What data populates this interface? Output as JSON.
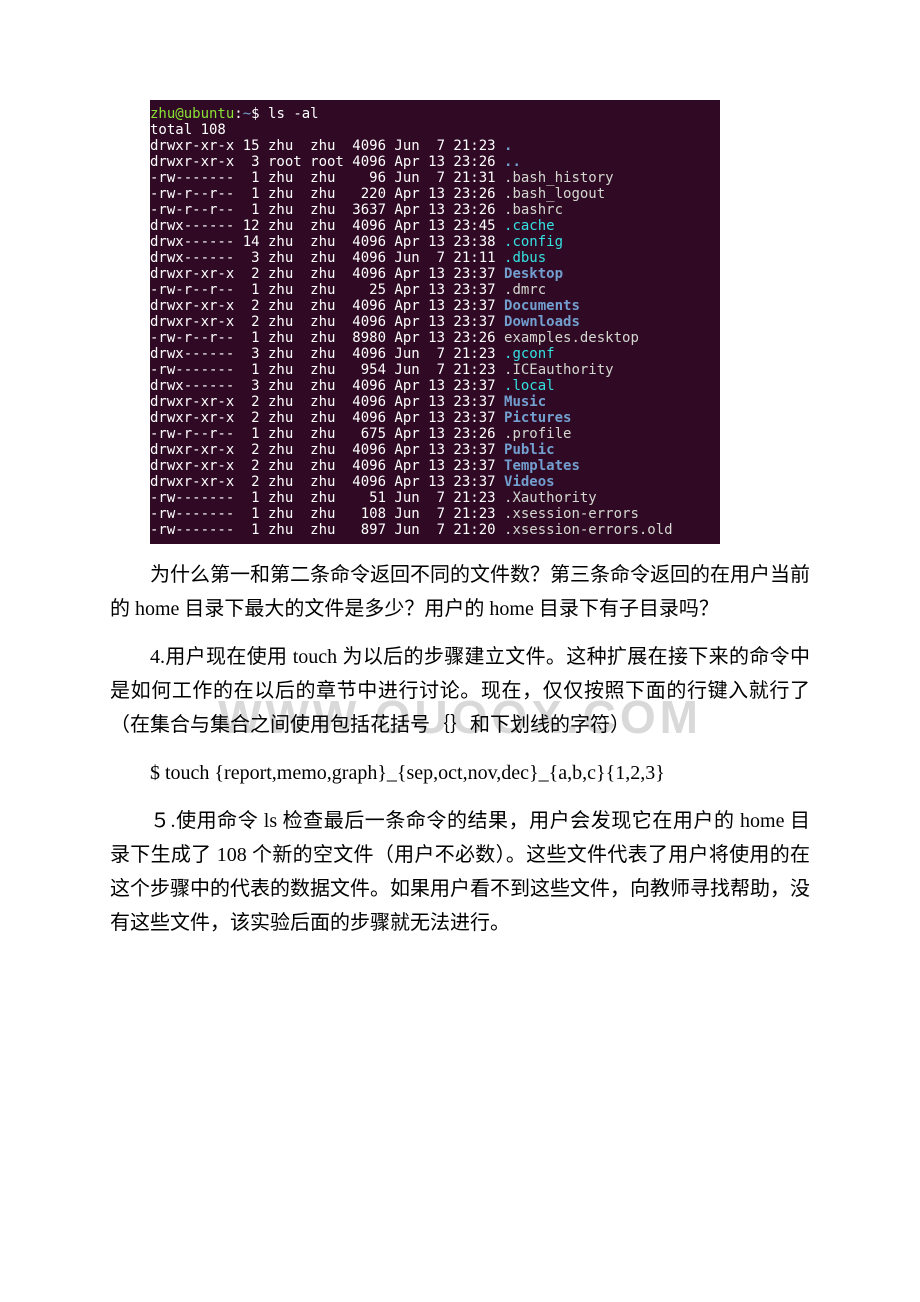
{
  "terminal": {
    "prompt": {
      "user": "zhu@ubuntu",
      "sep": ":",
      "path": "~",
      "sym": "$ ",
      "command": "ls -al"
    },
    "totals": "total 108",
    "rows": [
      {
        "perm": "drwxr-xr-x",
        "n": "15",
        "o": "zhu",
        "g": "zhu",
        "s": "4096",
        "m": "Jun",
        "d": " 7",
        "t": "21:23",
        "name": ".",
        "cls": "dir"
      },
      {
        "perm": "drwxr-xr-x",
        "n": " 3",
        "o": "root",
        "g": "root",
        "s": "4096",
        "m": "Apr",
        "d": "13",
        "t": "23:26",
        "name": "..",
        "cls": "dir"
      },
      {
        "perm": "-rw-------",
        "n": " 1",
        "o": "zhu",
        "g": "zhu",
        "s": "  96",
        "m": "Jun",
        "d": " 7",
        "t": "21:31",
        "name": ".bash_history",
        "cls": "norm"
      },
      {
        "perm": "-rw-r--r--",
        "n": " 1",
        "o": "zhu",
        "g": "zhu",
        "s": " 220",
        "m": "Apr",
        "d": "13",
        "t": "23:26",
        "name": ".bash_logout",
        "cls": "norm"
      },
      {
        "perm": "-rw-r--r--",
        "n": " 1",
        "o": "zhu",
        "g": "zhu",
        "s": "3637",
        "m": "Apr",
        "d": "13",
        "t": "23:26",
        "name": ".bashrc",
        "cls": "norm"
      },
      {
        "perm": "drwx------",
        "n": "12",
        "o": "zhu",
        "g": "zhu",
        "s": "4096",
        "m": "Apr",
        "d": "13",
        "t": "23:45",
        "name": ".cache",
        "cls": "hid"
      },
      {
        "perm": "drwx------",
        "n": "14",
        "o": "zhu",
        "g": "zhu",
        "s": "4096",
        "m": "Apr",
        "d": "13",
        "t": "23:38",
        "name": ".config",
        "cls": "hid"
      },
      {
        "perm": "drwx------",
        "n": " 3",
        "o": "zhu",
        "g": "zhu",
        "s": "4096",
        "m": "Jun",
        "d": " 7",
        "t": "21:11",
        "name": ".dbus",
        "cls": "hid"
      },
      {
        "perm": "drwxr-xr-x",
        "n": " 2",
        "o": "zhu",
        "g": "zhu",
        "s": "4096",
        "m": "Apr",
        "d": "13",
        "t": "23:37",
        "name": "Desktop",
        "cls": "dir"
      },
      {
        "perm": "-rw-r--r--",
        "n": " 1",
        "o": "zhu",
        "g": "zhu",
        "s": "  25",
        "m": "Apr",
        "d": "13",
        "t": "23:37",
        "name": ".dmrc",
        "cls": "norm"
      },
      {
        "perm": "drwxr-xr-x",
        "n": " 2",
        "o": "zhu",
        "g": "zhu",
        "s": "4096",
        "m": "Apr",
        "d": "13",
        "t": "23:37",
        "name": "Documents",
        "cls": "dir"
      },
      {
        "perm": "drwxr-xr-x",
        "n": " 2",
        "o": "zhu",
        "g": "zhu",
        "s": "4096",
        "m": "Apr",
        "d": "13",
        "t": "23:37",
        "name": "Downloads",
        "cls": "dir"
      },
      {
        "perm": "-rw-r--r--",
        "n": " 1",
        "o": "zhu",
        "g": "zhu",
        "s": "8980",
        "m": "Apr",
        "d": "13",
        "t": "23:26",
        "name": "examples.desktop",
        "cls": "norm"
      },
      {
        "perm": "drwx------",
        "n": " 3",
        "o": "zhu",
        "g": "zhu",
        "s": "4096",
        "m": "Jun",
        "d": " 7",
        "t": "21:23",
        "name": ".gconf",
        "cls": "hid"
      },
      {
        "perm": "-rw-------",
        "n": " 1",
        "o": "zhu",
        "g": "zhu",
        "s": " 954",
        "m": "Jun",
        "d": " 7",
        "t": "21:23",
        "name": ".ICEauthority",
        "cls": "norm"
      },
      {
        "perm": "drwx------",
        "n": " 3",
        "o": "zhu",
        "g": "zhu",
        "s": "4096",
        "m": "Apr",
        "d": "13",
        "t": "23:37",
        "name": ".local",
        "cls": "hid"
      },
      {
        "perm": "drwxr-xr-x",
        "n": " 2",
        "o": "zhu",
        "g": "zhu",
        "s": "4096",
        "m": "Apr",
        "d": "13",
        "t": "23:37",
        "name": "Music",
        "cls": "dir"
      },
      {
        "perm": "drwxr-xr-x",
        "n": " 2",
        "o": "zhu",
        "g": "zhu",
        "s": "4096",
        "m": "Apr",
        "d": "13",
        "t": "23:37",
        "name": "Pictures",
        "cls": "dir"
      },
      {
        "perm": "-rw-r--r--",
        "n": " 1",
        "o": "zhu",
        "g": "zhu",
        "s": " 675",
        "m": "Apr",
        "d": "13",
        "t": "23:26",
        "name": ".profile",
        "cls": "norm"
      },
      {
        "perm": "drwxr-xr-x",
        "n": " 2",
        "o": "zhu",
        "g": "zhu",
        "s": "4096",
        "m": "Apr",
        "d": "13",
        "t": "23:37",
        "name": "Public",
        "cls": "dir"
      },
      {
        "perm": "drwxr-xr-x",
        "n": " 2",
        "o": "zhu",
        "g": "zhu",
        "s": "4096",
        "m": "Apr",
        "d": "13",
        "t": "23:37",
        "name": "Templates",
        "cls": "dir"
      },
      {
        "perm": "drwxr-xr-x",
        "n": " 2",
        "o": "zhu",
        "g": "zhu",
        "s": "4096",
        "m": "Apr",
        "d": "13",
        "t": "23:37",
        "name": "Videos",
        "cls": "dir"
      },
      {
        "perm": "-rw-------",
        "n": " 1",
        "o": "zhu",
        "g": "zhu",
        "s": "  51",
        "m": "Jun",
        "d": " 7",
        "t": "21:23",
        "name": ".Xauthority",
        "cls": "norm"
      },
      {
        "perm": "-rw-------",
        "n": " 1",
        "o": "zhu",
        "g": "zhu",
        "s": " 108",
        "m": "Jun",
        "d": " 7",
        "t": "21:23",
        "name": ".xsession-errors",
        "cls": "norm"
      },
      {
        "perm": "-rw-------",
        "n": " 1",
        "o": "zhu",
        "g": "zhu",
        "s": " 897",
        "m": "Jun",
        "d": " 7",
        "t": "21:20",
        "name": ".xsession-errors.old",
        "cls": "norm"
      }
    ]
  },
  "body": {
    "p1": "为什么第一和第二条命令返回不同的文件数？第三条命令返回的在用户当前的 home 目录下最大的文件是多少？用户的 home 目录下有子目录吗？",
    "p2": "4.用户现在使用 touch 为以后的步骤建立文件。这种扩展在接下来的命令中是如何工作的在以后的章节中进行讨论。现在，仅仅按照下面的行键入就行了（在集合与集合之间使用包括花括号｛｝和下划线的字符）",
    "cmd": "$ touch {report,memo,graph}_{sep,oct,nov,dec}_{a,b,c}{1,2,3}",
    "p3": "５.使用命令 ls 检查最后一条命令的结果，用户会发现它在用户的 home 目录下生成了 108 个新的空文件（用户不必数）。这些文件代表了用户将使用的在这个步骤中的代表的数据文件。如果用户看不到这些文件，向教师寻找帮助，没有这些文件，该实验后面的步骤就无法进行。"
  },
  "watermark": "WWW.OUOOX.COM"
}
